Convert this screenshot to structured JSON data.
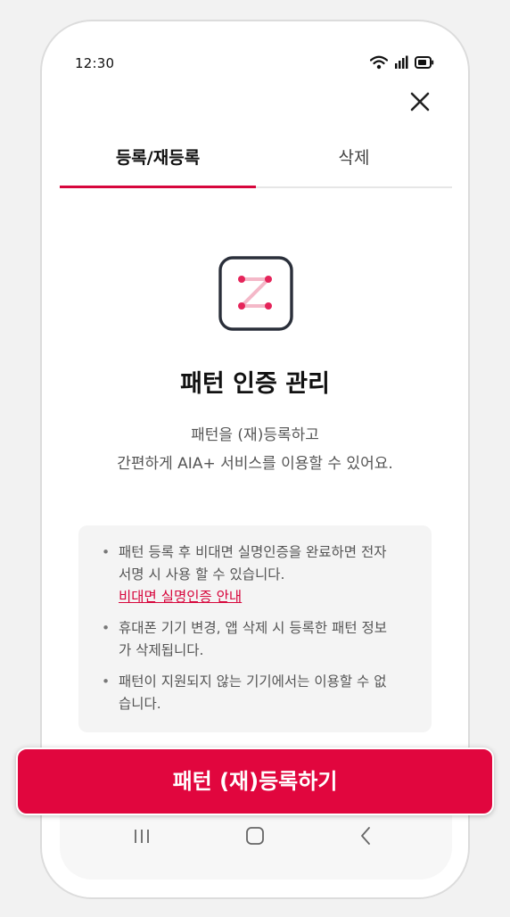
{
  "status_bar": {
    "time": "12:30",
    "icons": [
      "wifi-icon",
      "signal-icon",
      "battery-icon"
    ]
  },
  "header": {
    "close_icon": "close-icon"
  },
  "tabs": [
    {
      "label": "등록/재등록",
      "active": true
    },
    {
      "label": "삭제",
      "active": false
    }
  ],
  "main": {
    "logo_icon": "pattern-lock-icon",
    "title": "패턴 인증 관리",
    "description": [
      "패턴을 (재)등록하고",
      "간편하게 AIA+ 서비스를 이용할 수 있어요."
    ]
  },
  "info": {
    "items": [
      {
        "lines": [
          "패턴 등록 후 비대면 실명인증을 완료하면 전자",
          "서명 시 사용 할 수 있습니다."
        ],
        "link": "비대면 실명인증 안내"
      },
      {
        "lines": [
          "휴대폰 기기 변경, 앱 삭제 시 등록한 패턴 정보",
          "가 삭제됩니다."
        ]
      },
      {
        "lines": [
          "패턴이 지원되지 않는 기기에서는 이용할 수 없",
          "습니다."
        ]
      }
    ]
  },
  "cta": {
    "label": "패턴 (재)등록하기"
  },
  "nav_bar": {
    "icons": [
      "recent-apps-icon",
      "home-icon",
      "back-icon"
    ]
  },
  "colors": {
    "accent": "#e1063e",
    "tab_indicator": "#d7063c",
    "logo_dots": "#e5245a",
    "logo_line": "#f4b8c8"
  }
}
